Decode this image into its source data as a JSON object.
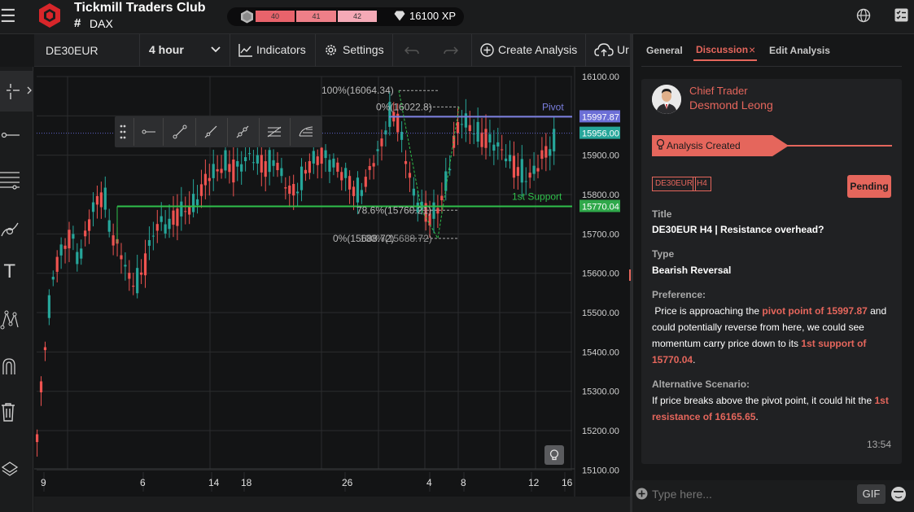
{
  "topbar": {
    "club_title": "Tickmill Traders Club",
    "channel_hash": "#",
    "channel": "DAX",
    "levels": [
      "40",
      "41",
      "42"
    ],
    "xp": "16100 XP",
    "icons": [
      "menu-icon",
      "gem-icon",
      "diamond-icon",
      "globe-icon",
      "tasks-icon"
    ]
  },
  "chart_toolbar": {
    "symbol": "DE30EUR",
    "interval": "4 hour",
    "indicators": "Indicators",
    "settings": "Settings",
    "create_analysis": "Create Analysis",
    "upload": "Ur"
  },
  "chart": {
    "price_ticks": [
      "16100.00",
      "16000.00",
      "15900.00",
      "15800.00",
      "15700.00",
      "15600.00",
      "15500.00",
      "15400.00",
      "15300.00",
      "15200.00",
      "15100.00"
    ],
    "date_ticks": [
      "9",
      "6",
      "14",
      "18",
      "26",
      "4",
      "8",
      "12",
      "16"
    ],
    "pivot_label": "Pivot",
    "pivot_price": "15997.87",
    "current_price": "15956.00",
    "support_label": "1st Support",
    "support_price": "15770.04",
    "fib_labels": [
      "100%(16064.34)",
      "0%(16022.8)",
      "78.6%(15760.21)",
      "0%(15688.72)"
    ],
    "fib_overlap_label": "100%(15688.72)",
    "colors": {
      "up": "#26a69a",
      "down": "#ef5350",
      "pivot": "#7b7fe0",
      "support": "#2fbf4b"
    }
  },
  "panel": {
    "tabs": [
      "General",
      "Discussion",
      "Edit Analysis"
    ],
    "active_tab": "Discussion",
    "author_role": "Chief Trader",
    "author_name": "Desmond Leong",
    "event": "Analysis Created",
    "tags": [
      "DE30EUR",
      "H4"
    ],
    "status": "Pending",
    "title_label": "Title",
    "title": "DE30EUR H4 | Resistance overhead?",
    "type_label": "Type",
    "type": "Bearish Reversal",
    "preference_label": "Preference:",
    "preference_1": " Price is approaching the ",
    "preference_hl1": "pivot point of 15997.87",
    "preference_2": " and could potentially reverse from here, we could see momentum carry price down to its ",
    "preference_hl2": "1st support of 15770.04",
    "preference_3": ".",
    "alt_label": "Alternative Scenario:",
    "alt_1": "If price breaks above the pivot point, it could hit the ",
    "alt_hl": "1st resistance of 16165.65",
    "alt_2": ".",
    "time": "13:54",
    "input_placeholder": "Type here...",
    "gif": "GIF"
  }
}
